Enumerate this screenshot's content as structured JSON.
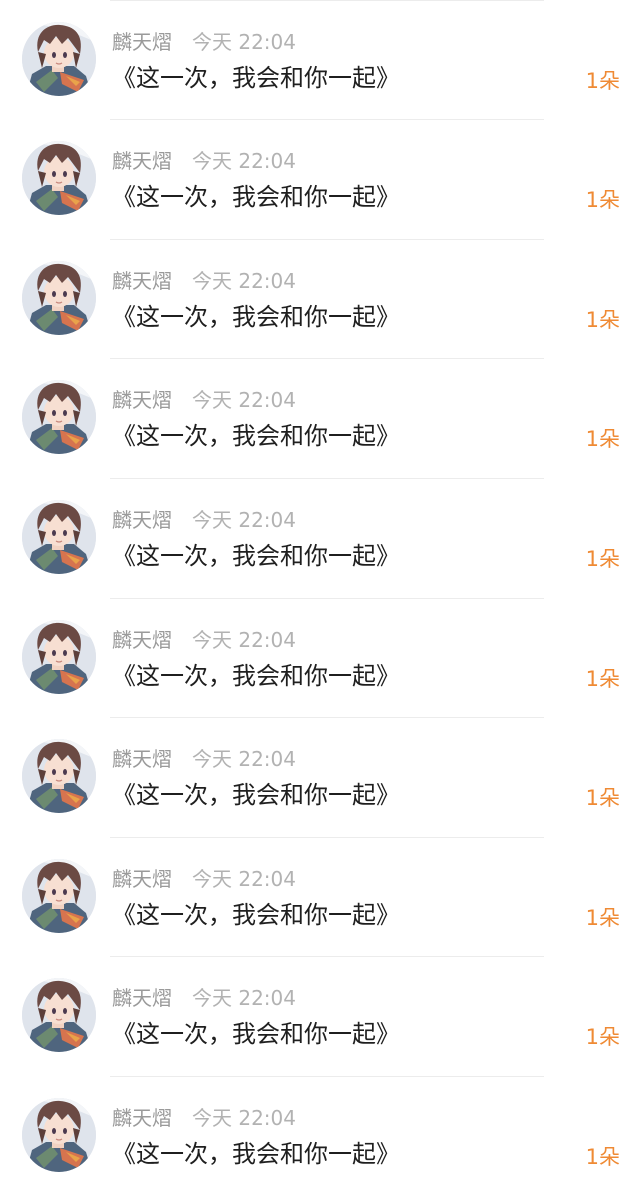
{
  "comments": [
    {
      "author": "麟天熠",
      "time": "今天 22:04",
      "text": "《这一次，我会和你一起》",
      "flowers": "1朵"
    },
    {
      "author": "麟天熠",
      "time": "今天 22:04",
      "text": "《这一次，我会和你一起》",
      "flowers": "1朵"
    },
    {
      "author": "麟天熠",
      "time": "今天 22:04",
      "text": "《这一次，我会和你一起》",
      "flowers": "1朵"
    },
    {
      "author": "麟天熠",
      "time": "今天 22:04",
      "text": "《这一次，我会和你一起》",
      "flowers": "1朵"
    },
    {
      "author": "麟天熠",
      "time": "今天 22:04",
      "text": "《这一次，我会和你一起》",
      "flowers": "1朵"
    },
    {
      "author": "麟天熠",
      "time": "今天 22:04",
      "text": "《这一次，我会和你一起》",
      "flowers": "1朵"
    },
    {
      "author": "麟天熠",
      "time": "今天 22:04",
      "text": "《这一次，我会和你一起》",
      "flowers": "1朵"
    },
    {
      "author": "麟天熠",
      "time": "今天 22:04",
      "text": "《这一次，我会和你一起》",
      "flowers": "1朵"
    },
    {
      "author": "麟天熠",
      "time": "今天 22:04",
      "text": "《这一次，我会和你一起》",
      "flowers": "1朵"
    },
    {
      "author": "麟天熠",
      "time": "今天 22:04",
      "text": "《这一次，我会和你一起》",
      "flowers": "1朵"
    }
  ]
}
